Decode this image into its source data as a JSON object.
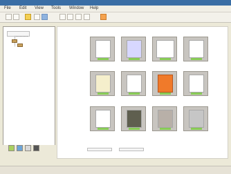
{
  "menu": {
    "items": [
      {
        "label": "File"
      },
      {
        "label": "Edit"
      },
      {
        "label": "View"
      },
      {
        "label": "Tools"
      },
      {
        "label": "Window"
      },
      {
        "label": "Help"
      }
    ]
  },
  "sidebar": {
    "root_label": "",
    "child_labels": [
      "",
      ""
    ]
  },
  "gallery": {
    "thumbnails": [
      {
        "name": "thumbnail-1",
        "color": "#cfcfcf"
      },
      {
        "name": "thumbnail-2",
        "color": "#d7d7ff"
      },
      {
        "name": "thumbnail-3",
        "color": "#d8d8d8"
      },
      {
        "name": "thumbnail-4",
        "color": "#d3d3d3"
      },
      {
        "name": "thumbnail-5",
        "color": "#d9d0a0"
      },
      {
        "name": "thumbnail-6",
        "color": "#d6d6d6"
      },
      {
        "name": "thumbnail-7",
        "color": "#f07a2a"
      },
      {
        "name": "thumbnail-8",
        "color": "#d5d5d5"
      },
      {
        "name": "thumbnail-9",
        "color": "#e1e1e1"
      },
      {
        "name": "thumbnail-10",
        "color": "#5f5f4f"
      },
      {
        "name": "thumbnail-11",
        "color": "#b8b0a8"
      },
      {
        "name": "thumbnail-12",
        "color": "#c6c6c6"
      }
    ]
  },
  "status": {
    "text": ""
  }
}
